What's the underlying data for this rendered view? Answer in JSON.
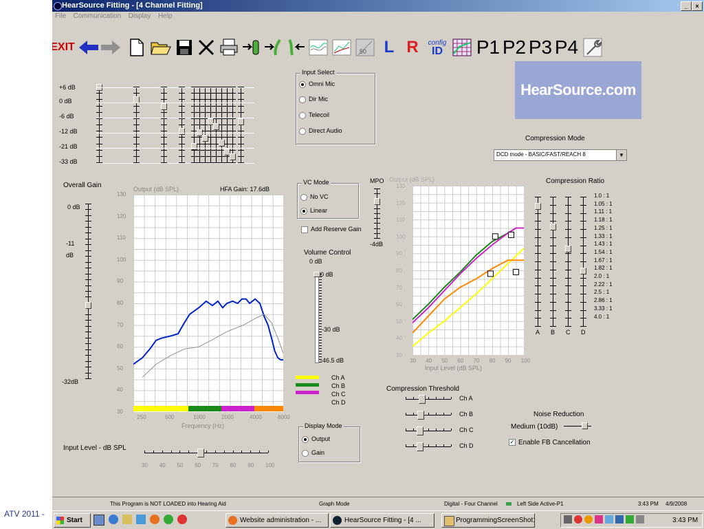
{
  "side_label": "ATV 2011 -",
  "window": {
    "title": "HearSource Fitting  - [4 Channel Fitting]",
    "buttons": [
      "_",
      "×"
    ],
    "menu": [
      "File",
      "Communication",
      "Display",
      "Help"
    ]
  },
  "toolbar": {
    "exit_label": "EXIT",
    "left_label": "L",
    "right_label": "R",
    "config_label": "config",
    "id_label": "ID",
    "programs": [
      "P1",
      "P2",
      "P3",
      "P4"
    ],
    "icons": [
      "back-arrow-icon",
      "forward-arrow-icon",
      "new-file-icon",
      "open-folder-icon",
      "save-disk-icon",
      "delete-x-icon",
      "print-icon",
      "read-aid-icon",
      "write-aid-icon",
      "undo-aid-icon",
      "response-curve-icon",
      "curve-compare-icon",
      "volume-50-icon",
      "grid-chart-icon",
      "wrench-icon"
    ]
  },
  "banner": {
    "text": "HearSource.com",
    "color": "#9aa6d4"
  },
  "top_sliders": {
    "labels": [
      "+6 dB",
      "0 dB",
      "-6 dB",
      "-12 dB",
      "-21 dB",
      "-33 dB"
    ],
    "positions": [
      1.0,
      0.84,
      0.75,
      0.42,
      0.22,
      0.4,
      0.33,
      0.55,
      0.48,
      0.26,
      0.15,
      0.08,
      0.55
    ]
  },
  "input_select": {
    "title": "Input Select",
    "options": [
      "Omni Mic",
      "Dir Mic",
      "Telecoil",
      "Direct Audio"
    ],
    "selected": 0
  },
  "compression_mode": {
    "title": "Compression Mode",
    "value": "DCD mode - BASIC/FAST/REACH 8"
  },
  "overall_gain": {
    "title": "Overall Gain",
    "top": "0 dB",
    "mid1": "-11",
    "mid2": "dB",
    "bottom": "-32dB",
    "level": 0.42
  },
  "left_chart": {
    "ylabel": "Output (dB SPL)",
    "hfa": "HFA Gain: 17.6dB",
    "yticks": [
      "130",
      "120",
      "110",
      "100",
      "90",
      "80",
      "70",
      "60",
      "50",
      "40",
      "30"
    ],
    "xticks": [
      "250",
      "500",
      "1000",
      "2000",
      "4000",
      "8000"
    ],
    "xlabel": "Frequency (Hz)",
    "channel_bar_colors": [
      "#ffff00",
      "#1a8a1a",
      "#cc22cc",
      "#ff8800"
    ]
  },
  "chart_data": [
    {
      "type": "line",
      "title": "",
      "ylabel": "Output (dB SPL)",
      "xlabel": "Frequency (Hz)",
      "xscale": "log",
      "xlim": [
        200,
        8000
      ],
      "ylim": [
        30,
        130
      ],
      "series": [
        {
          "color": "#0022cc",
          "x": [
            200,
            250,
            300,
            350,
            400,
            500,
            600,
            700,
            800,
            1000,
            1200,
            1400,
            1600,
            1800,
            2000,
            2300,
            2600,
            2900,
            3200,
            3500,
            4000,
            4500,
            5000,
            5500,
            6000,
            6500,
            7000,
            7500,
            8000
          ],
          "y": [
            52,
            55,
            59,
            63,
            64,
            65,
            66,
            71,
            75,
            78,
            81,
            79,
            81,
            78,
            80,
            81,
            80,
            82,
            82,
            80,
            82,
            80,
            74,
            70,
            64,
            58,
            55,
            54,
            54
          ]
        },
        {
          "color": "#909090",
          "x": [
            250,
            350,
            500,
            700,
            1000,
            1500,
            2000,
            3000,
            4000,
            5000,
            6000,
            7000,
            8000
          ],
          "y": [
            46,
            52,
            56,
            59,
            60,
            64,
            67,
            70,
            73,
            75,
            71,
            64,
            57
          ]
        }
      ]
    },
    {
      "type": "line",
      "title": "",
      "ylabel": "Output (dB SPL)",
      "xlabel": "Input Level (dB SPL)",
      "xlim": [
        30,
        100
      ],
      "ylim": [
        30,
        130
      ],
      "series": [
        {
          "name": "Ch A",
          "color": "#ffff00",
          "x": [
            30,
            40,
            50,
            60,
            70,
            80,
            90,
            100
          ],
          "y": [
            35,
            43,
            50,
            58,
            66,
            75,
            84,
            93
          ]
        },
        {
          "name": "Ch B",
          "color": "#1a8a1a",
          "x": [
            30,
            40,
            50,
            60,
            70,
            80,
            90,
            95,
            100
          ],
          "y": [
            51,
            60,
            70,
            79,
            89,
            97,
            102,
            105,
            105
          ]
        },
        {
          "name": "Ch C",
          "color": "#ff8800",
          "x": [
            30,
            40,
            50,
            60,
            70,
            80,
            90,
            100
          ],
          "y": [
            43,
            53,
            63,
            70,
            75,
            81,
            86,
            86
          ]
        },
        {
          "name": "Ch D",
          "color": "#cc22cc",
          "x": [
            30,
            40,
            50,
            60,
            70,
            80,
            90,
            95,
            100
          ],
          "y": [
            49,
            58,
            68,
            78,
            87,
            95,
            102,
            105,
            105
          ]
        }
      ],
      "xticks": [
        "30",
        "40",
        "50",
        "60",
        "70",
        "80",
        "90",
        "100"
      ],
      "yticks": [
        "130",
        "120",
        "110",
        "100",
        "90",
        "80",
        "70",
        "60",
        "50",
        "40",
        "30"
      ]
    }
  ],
  "vc_mode": {
    "title": "VC Mode",
    "options": [
      "No VC",
      "Linear"
    ],
    "selected": 1,
    "reserve": "Add Reserve Gain"
  },
  "volume_control": {
    "title": "Volume Control",
    "sub": "0 dB",
    "ticks": [
      "0 dB",
      "-30 dB",
      "-46.5 dB"
    ],
    "level": 1.0
  },
  "mpo": {
    "title": "MPO",
    "bottom": "-4dB",
    "level": 0.75
  },
  "legend": [
    {
      "label": "Ch A",
      "color": "#ffff00"
    },
    {
      "label": "Ch B",
      "color": "#1a8a1a"
    },
    {
      "label": "Ch C",
      "color": "#cc22cc"
    },
    {
      "label": "Ch D",
      "color": "#ff8800"
    }
  ],
  "display_mode": {
    "title": "Display Mode",
    "options": [
      "Output",
      "Gain"
    ],
    "selected": 0
  },
  "compression_threshold": {
    "title": "Compression Threshold",
    "channels": [
      "Ch A",
      "Ch B",
      "Ch C",
      "Ch D"
    ],
    "levels": [
      0.35,
      0.32,
      0.3,
      0.3
    ]
  },
  "right_chart": {
    "ylabel": "Output (dB SPL)",
    "xlabel": "Input Level (dB SPL)"
  },
  "compression_ratio": {
    "title": "Compression Ratio",
    "values": [
      "1.0 : 1",
      "1.05 : 1",
      "1.11 : 1",
      "1.18 : 1",
      "1.25 : 1",
      "1.33 : 1",
      "1.43 : 1",
      "1.54 : 1",
      "1.67 : 1",
      "1.82 : 1",
      "2.0 : 1",
      "2.22 : 1",
      "2.5 : 1",
      "2.86 : 1",
      "3.33 : 1",
      "4.0 : 1"
    ],
    "channels": [
      "A",
      "B",
      "C",
      "D"
    ],
    "levels": [
      0.93,
      0.77,
      0.6,
      0.43
    ]
  },
  "noise_reduction": {
    "title": "Noise Reduction",
    "value": "Medium (10dB)",
    "fb": "Enable FB Cancellation"
  },
  "input_level": {
    "title": "Input Level - dB SPL",
    "ticks": [
      "30",
      "40",
      "50",
      "60",
      "70",
      "80",
      "90",
      "100"
    ],
    "level": 0.45
  },
  "status": {
    "program": "This Program is NOT LOADED into Hearing Aid",
    "mode": "Graph Mode",
    "channel": "Digital - Four Channel",
    "side": "Left Side Active-P1",
    "time": "3:43 PM",
    "date": "4/9/2008"
  },
  "taskbar": {
    "start": "Start",
    "tasks": [
      "Website administration - ...",
      "HearSource Fitting  - [4 ...",
      "ProgrammingScreenShot1..."
    ],
    "clock": "3:43 PM"
  }
}
